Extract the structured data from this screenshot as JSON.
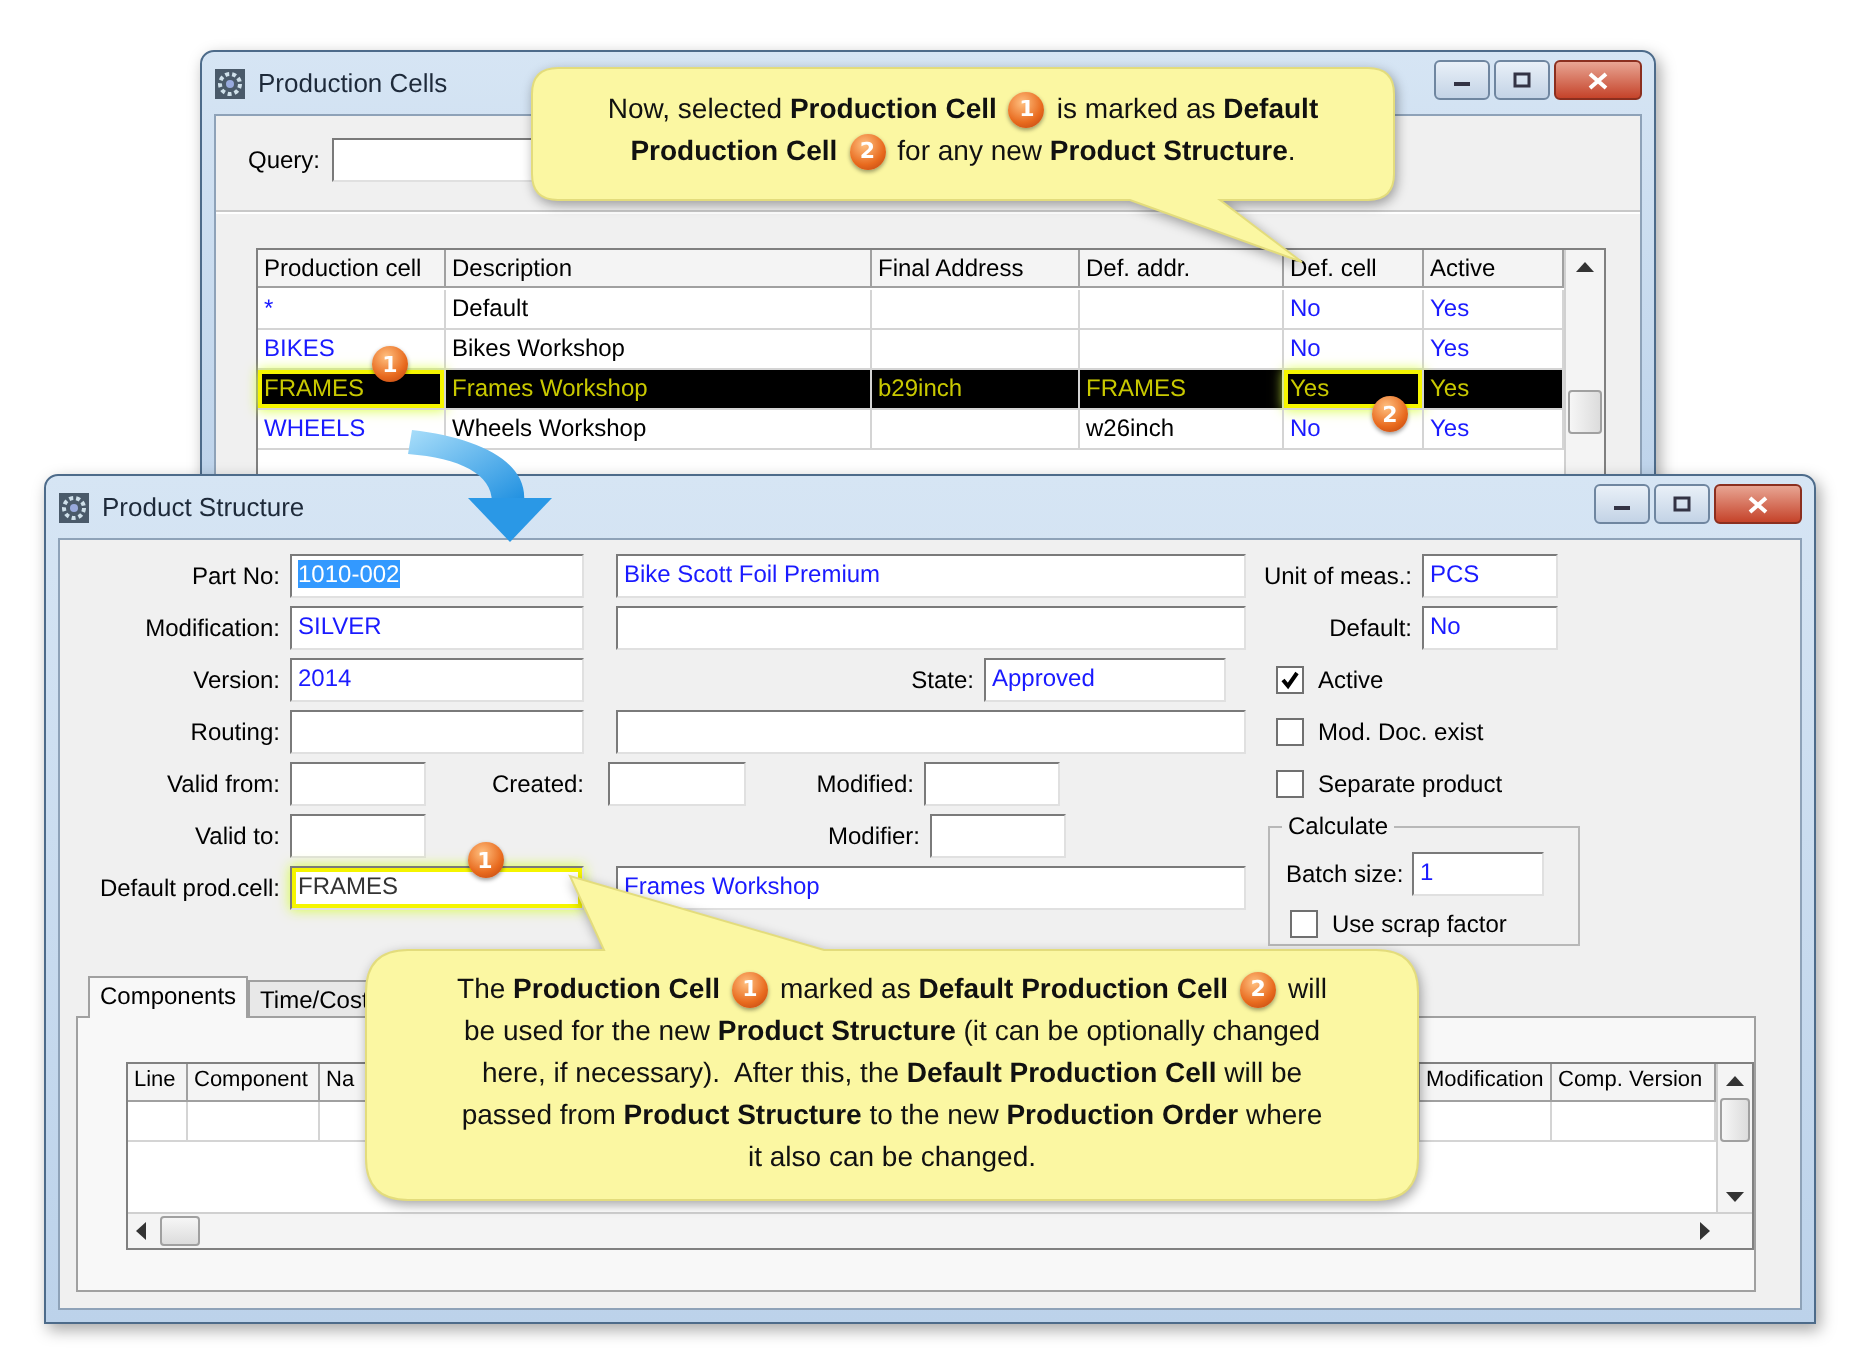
{
  "production_cells": {
    "title": "Production Cells",
    "query_label": "Query:",
    "columns": [
      {
        "label": "Production cell",
        "kind": "key"
      },
      {
        "label": "Description",
        "kind": "text"
      },
      {
        "label": "Final Address",
        "kind": "text"
      },
      {
        "label": "Def. addr.",
        "kind": "text"
      },
      {
        "label": "Def. cell",
        "kind": "key"
      },
      {
        "label": "Active",
        "kind": "key"
      }
    ],
    "rows": [
      {
        "selected": false,
        "cells": [
          {
            "text": "*"
          },
          {
            "text": "Default"
          },
          {},
          {},
          {
            "text": "No"
          },
          {
            "text": "Yes"
          }
        ]
      },
      {
        "selected": false,
        "cells": [
          {
            "text": "BIKES"
          },
          {
            "text": "Bikes Workshop"
          },
          {},
          {},
          {
            "text": "No"
          },
          {
            "text": "Yes"
          }
        ]
      },
      {
        "selected": true,
        "cells": [
          {
            "text": "FRAMES",
            "highlighted": true,
            "badge": "1"
          },
          {
            "text": "Frames Workshop"
          },
          {
            "text": "b29inch"
          },
          {
            "text": "FRAMES"
          },
          {
            "text": "Yes",
            "highlighted": true,
            "badge": "2"
          },
          {
            "text": "Yes"
          }
        ]
      },
      {
        "selected": false,
        "cells": [
          {
            "text": "WHEELS"
          },
          {
            "text": "Wheels Workshop"
          },
          {},
          {
            "text": "w26inch"
          },
          {
            "text": "No"
          },
          {
            "text": "Yes"
          }
        ]
      }
    ]
  },
  "product_structure": {
    "title": "Product Structure",
    "part_no": {
      "label": "Part No:",
      "value": "1010-002",
      "text_selected": true
    },
    "part_description": {
      "value": "Bike Scott Foil Premium"
    },
    "modification": {
      "label": "Modification:",
      "value": "SILVER"
    },
    "version": {
      "label": "Version:",
      "value": "2014"
    },
    "state": {
      "label": "State:",
      "value": "Approved"
    },
    "routing": {
      "label": "Routing:"
    },
    "valid_from": {
      "label": "Valid from:"
    },
    "created": {
      "label": "Created:"
    },
    "modified": {
      "label": "Modified:"
    },
    "valid_to": {
      "label": "Valid to:"
    },
    "modifier": {
      "label": "Modifier:"
    },
    "default_prod_cell": {
      "label": "Default prod.cell:",
      "value": "FRAMES",
      "highlighted": true,
      "badge": "1"
    },
    "default_prod_cell_description": {
      "value": "Frames Workshop"
    },
    "unit_of_meas": {
      "label": "Unit of meas.:",
      "value": "PCS"
    },
    "default": {
      "label": "Default:",
      "value": "No"
    },
    "checkboxes": [
      {
        "label": "Active",
        "checked": true
      },
      {
        "label": "Mod. Doc. exist",
        "checked": false
      },
      {
        "label": "Separate product",
        "checked": false
      }
    ],
    "calculate": {
      "title": "Calculate",
      "batch_size": {
        "label": "Batch size:",
        "value": "1"
      },
      "use_scrap_factor": {
        "label": "Use scrap factor",
        "checked": false
      }
    },
    "tabs": [
      {
        "label": "Components",
        "selected": true
      },
      {
        "label": "Time/Cost",
        "selected": false
      }
    ],
    "components_columns": [
      "Line",
      "Component",
      "Na",
      "Modification",
      "Comp. Version"
    ]
  },
  "callouts": [
    {
      "lines": [
        [
          {
            "kind": "text",
            "text": "Now, selected **Production Cell**"
          },
          {
            "kind": "badge",
            "text": "1"
          },
          {
            "kind": "text",
            "text": "is marked as **Default**"
          }
        ],
        [
          {
            "kind": "text",
            "text": "**Production Cell**"
          },
          {
            "kind": "badge",
            "text": "2"
          },
          {
            "kind": "text",
            "text": "for any new **Product Structure**."
          }
        ]
      ]
    },
    {
      "lines": [
        [
          {
            "kind": "text",
            "text": "The **Production Cell**"
          },
          {
            "kind": "badge",
            "text": "1"
          },
          {
            "kind": "text",
            "text": "marked as **Default Production Cell**"
          },
          {
            "kind": "badge",
            "text": "2"
          },
          {
            "kind": "text",
            "text": "will"
          }
        ],
        [
          {
            "kind": "text",
            "text": "be used for the new **Product Structure** (it can be optionally changed"
          }
        ],
        [
          {
            "kind": "text",
            "text": "here, if necessary).  After this, the **Default Production Cell** will be"
          }
        ],
        [
          {
            "kind": "text",
            "text": "passed from **Product Structure** to the new **Production Order** where"
          }
        ],
        [
          {
            "kind": "text",
            "text": "it also can be changed."
          }
        ]
      ]
    }
  ]
}
